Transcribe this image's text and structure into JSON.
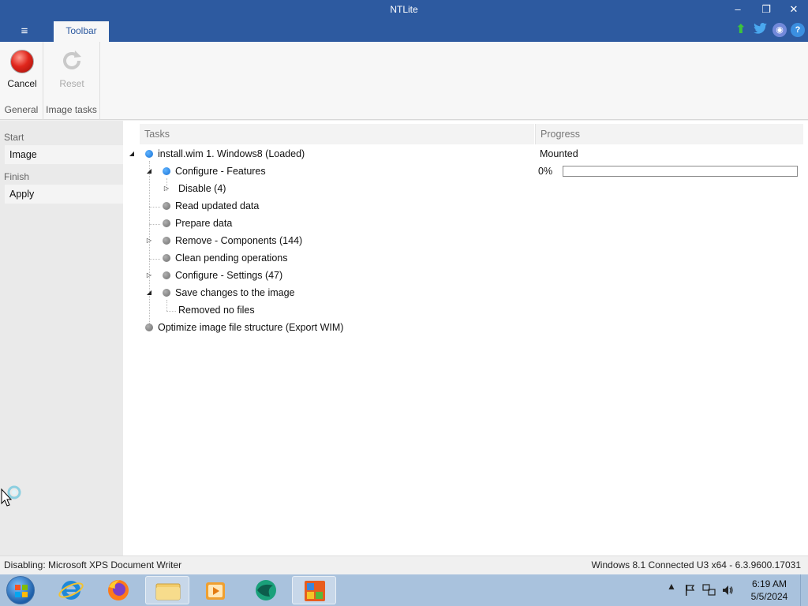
{
  "window": {
    "title": "NTLite",
    "minimize": "–",
    "restore": "❐",
    "close": "✕",
    "menu_icon": "≡",
    "tab": "Toolbar"
  },
  "ribbon": {
    "cancel_label": "Cancel",
    "reset_label": "Reset",
    "group_general": "General",
    "group_image_tasks": "Image tasks"
  },
  "sidebar": {
    "start_heading": "Start",
    "image_item": "Image",
    "finish_heading": "Finish",
    "apply_item": "Apply"
  },
  "columns": {
    "tasks": "Tasks",
    "progress": "Progress"
  },
  "tasks": [
    {
      "label": "install.wim 1. Windows8  (Loaded)",
      "progress": "Mounted"
    },
    {
      "label": "Configure - Features",
      "progress": "0%"
    },
    {
      "label": "Disable (4)"
    },
    {
      "label": "Read updated data"
    },
    {
      "label": "Prepare data"
    },
    {
      "label": "Remove - Components (144)"
    },
    {
      "label": "Clean pending operations"
    },
    {
      "label": "Configure - Settings (47)"
    },
    {
      "label": "Save changes to the image"
    },
    {
      "label": "Removed no files"
    },
    {
      "label": "Optimize image file structure (Export WIM)"
    }
  ],
  "progress_bar": {
    "value": 0
  },
  "status": {
    "left": "Disabling: Microsoft XPS Document Writer",
    "right": "Windows 8.1 Connected U3 x64 - 6.3.9600.17031"
  },
  "taskbar": {
    "time": "6:19 AM",
    "date": "5/5/2024",
    "tray_up": "▲"
  },
  "colors": {
    "titlebar": "#2d5aa0",
    "accent_blue": "#1a73d6",
    "taskbar": "#a9c2dd"
  }
}
